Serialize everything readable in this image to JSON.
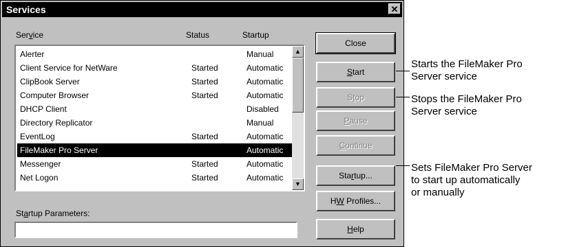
{
  "window": {
    "title": "Services",
    "close_glyph": "✕"
  },
  "list": {
    "headers": {
      "service": "Service",
      "status": "Status",
      "startup": "Startup"
    },
    "rows": [
      {
        "service": "Alerter",
        "status": "",
        "startup": "Manual"
      },
      {
        "service": "Client Service for NetWare",
        "status": "Started",
        "startup": "Automatic"
      },
      {
        "service": "ClipBook Server",
        "status": "Started",
        "startup": "Automatic"
      },
      {
        "service": "Computer Browser",
        "status": "Started",
        "startup": "Automatic"
      },
      {
        "service": "DHCP Client",
        "status": "",
        "startup": "Disabled"
      },
      {
        "service": "Directory Replicator",
        "status": "",
        "startup": "Manual"
      },
      {
        "service": "EventLog",
        "status": "Started",
        "startup": "Automatic"
      },
      {
        "service": "FileMaker Pro Server",
        "status": "",
        "startup": "Automatic"
      },
      {
        "service": "Messenger",
        "status": "Started",
        "startup": "Automatic"
      },
      {
        "service": "Net Logon",
        "status": "Started",
        "startup": "Automatic"
      }
    ],
    "selected_row": "FileMaker Pro Server",
    "scroll_up_glyph": "▲",
    "scroll_down_glyph": "▼"
  },
  "params": {
    "label": "Startup Parameters:",
    "value": ""
  },
  "buttons": {
    "close": "Close",
    "start": "Start",
    "stop": "Stop",
    "pause": "Pause",
    "continue": "Continue",
    "startup": "Startup...",
    "hw_profiles": "HW Profiles...",
    "help": "Help"
  },
  "annotations": {
    "start_line1": "Starts the FileMaker Pro",
    "start_line2": "Server service",
    "stop_line1": "Stops the FileMaker Pro",
    "stop_line2": "Server service",
    "startup_line1": "Sets FileMaker Pro Server",
    "startup_line2": "to start up automatically",
    "startup_line3": "or manually"
  }
}
